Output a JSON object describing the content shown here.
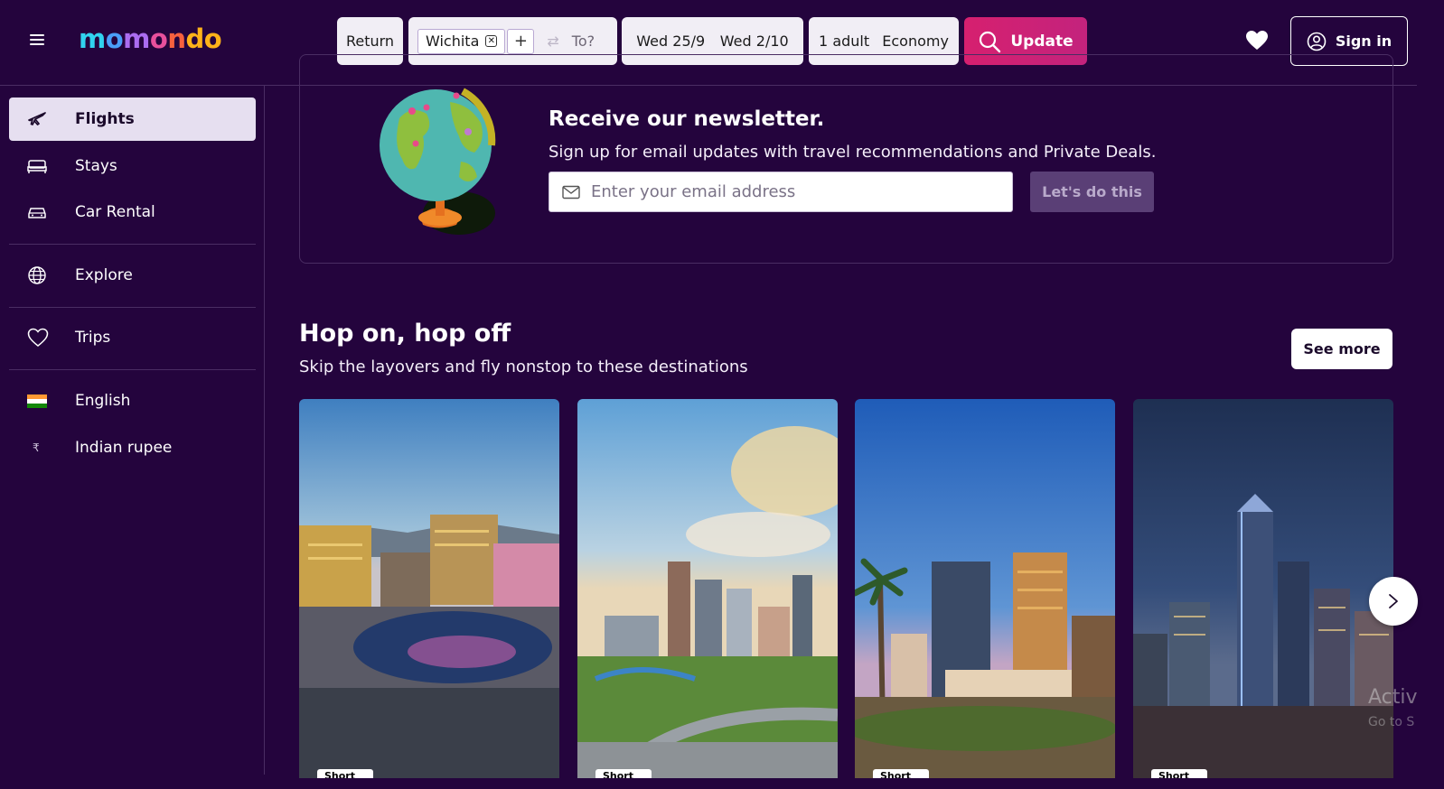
{
  "header": {
    "logo": [
      "m",
      "o",
      "m",
      "o",
      "n",
      "do"
    ],
    "trip_type": "Return",
    "origin": "Wichita",
    "destination_placeholder": "To?",
    "depart_date": "Wed 25/9",
    "return_date": "Wed 2/10",
    "travellers": "1 adult",
    "cabin": "Economy",
    "search_label": "Update",
    "sign_in_label": "Sign in"
  },
  "sidebar": {
    "items": [
      {
        "label": "Flights",
        "icon": "plane-icon",
        "active": true
      },
      {
        "label": "Stays",
        "icon": "bed-icon"
      },
      {
        "label": "Car Rental",
        "icon": "car-icon"
      },
      {
        "label": "Explore",
        "icon": "globe-icon"
      },
      {
        "label": "Trips",
        "icon": "heart-icon"
      },
      {
        "label": "English",
        "icon": "india-flag-icon"
      },
      {
        "label": "Indian rupee",
        "icon": "rupee-icon",
        "symbol": "₹"
      }
    ]
  },
  "newsletter": {
    "title": "Receive our newsletter.",
    "subtitle": "Sign up for email updates with travel recommendations and Private Deals.",
    "email_placeholder": "Enter your email address",
    "button_label": "Let's do this"
  },
  "section": {
    "title": "Hop on, hop off",
    "subtitle": "Skip the layovers and fly nonstop to these destinations",
    "see_more_label": "See more",
    "cards": [
      {
        "tag": "Short"
      },
      {
        "tag": "Short"
      },
      {
        "tag": "Short"
      },
      {
        "tag": "Short"
      }
    ]
  },
  "watermark": {
    "line1": "Activ",
    "line2": "Go to S"
  },
  "colors": {
    "background": "#24043d",
    "accent": "#d6206f",
    "active_nav": "#e6dff0"
  }
}
